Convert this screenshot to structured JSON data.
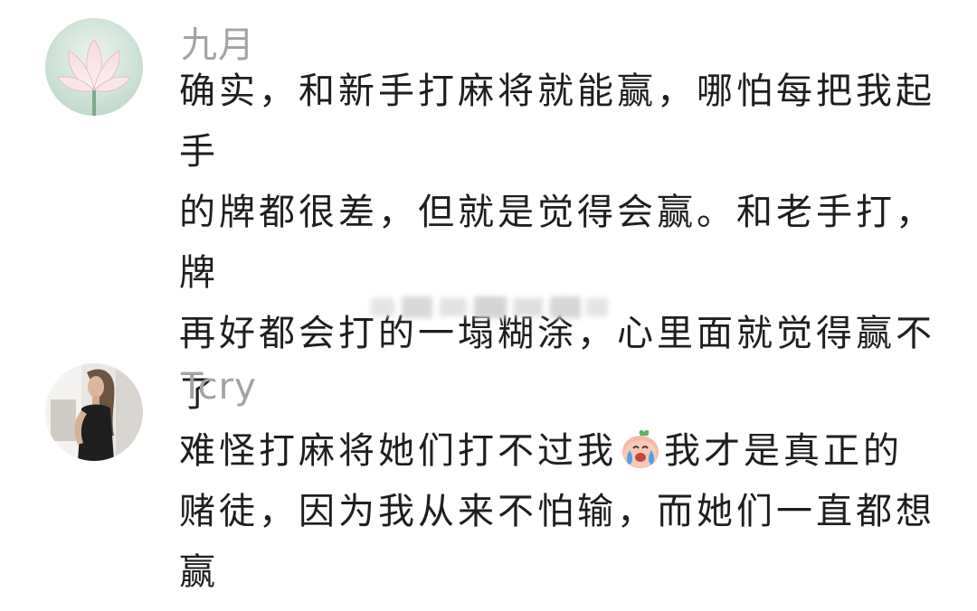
{
  "comments": [
    {
      "username": "九月",
      "avatar_icon": "lotus-flower-avatar",
      "lines": [
        "确实，和新手打麻将就能赢，哪怕每把我起手",
        "的牌都很差，但就是觉得会赢。和老手打，牌",
        "再好都会打的一塌糊涂，心里面就觉得赢不了"
      ]
    },
    {
      "username": "Tcry",
      "avatar_icon": "woman-portrait-avatar",
      "line1_before_emoji": "难怪打麻将她们打不过我",
      "emoji_icon": "crying-laughing-peach-emoji",
      "line1_after_emoji": "我才是真正的",
      "line2": "赌徒，因为我从来不怕输，而她们一直都想",
      "line3": "赢"
    }
  ],
  "colors": {
    "username": "#a3a3a3",
    "text": "#1e1e1e",
    "background": "#ffffff"
  }
}
